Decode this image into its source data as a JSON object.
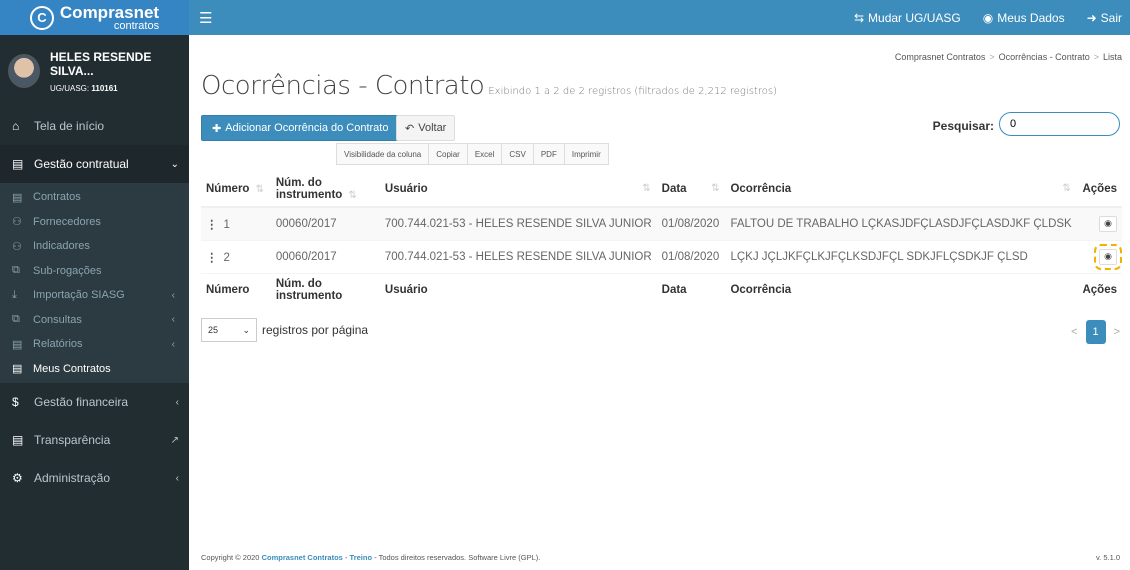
{
  "brand": {
    "name": "Comprasnet",
    "sub": "contratos"
  },
  "topnav": {
    "change_ug": "Mudar UG/UASG",
    "my_data": "Meus Dados",
    "logout": "Sair"
  },
  "user": {
    "name": "HELES RESENDE SILVA...",
    "uasg_label": "UG/UASG:",
    "uasg_code": "110161"
  },
  "sidebar": {
    "home": "Tela de início",
    "contract_mgmt": "Gestão contratual",
    "sub": [
      "Contratos",
      "Fornecedores",
      "Indicadores",
      "Sub-rogações",
      "Importação SIASG",
      "Consultas",
      "Relatórios",
      "Meus Contratos"
    ],
    "financial": "Gestão financeira",
    "transparency": "Transparência",
    "admin": "Administração"
  },
  "breadcrumb": [
    "Comprasnet Contratos",
    "Ocorrências - Contrato",
    "Lista"
  ],
  "page": {
    "title": "Ocorrências - Contrato",
    "subtitle": "Exibindo 1 a 2 de 2 registros (filtrados de 2,212 registros)"
  },
  "buttons": {
    "add": "Adicionar Ocorrência do Contrato",
    "back": "Voltar"
  },
  "search": {
    "label": "Pesquisar:",
    "value": "0"
  },
  "export_buttons": [
    "Visibilidade da coluna",
    "Copiar",
    "Excel",
    "CSV",
    "PDF",
    "Imprimir"
  ],
  "table": {
    "columns": [
      "Número",
      "Núm. do instrumento",
      "Usuário",
      "Data",
      "Ocorrência",
      "Ações"
    ],
    "rows": [
      {
        "numero": "1",
        "instrumento": "00060/2017",
        "usuario": "700.744.021-53 - HELES RESENDE SILVA JUNIOR",
        "data": "01/08/2020",
        "ocorrencia": "FALTOU DE TRABALHO LÇKASJDFÇLASDJFÇLASDJKF ÇLDSK"
      },
      {
        "numero": "2",
        "instrumento": "00060/2017",
        "usuario": "700.744.021-53 - HELES RESENDE SILVA JUNIOR",
        "data": "01/08/2020",
        "ocorrencia": "LÇKJ JÇLJKFÇLKJFÇLKSDJFÇL SDKJFLÇSDKJF ÇLSD"
      }
    ]
  },
  "pagination": {
    "per_page": "25",
    "per_page_label": "registros por página",
    "current": "1",
    "prev": "<",
    "next": ">"
  },
  "footer": {
    "copyright": "Copyright © 2020",
    "app": "Comprasnet Contratos",
    "dash": "-",
    "env": "Treino",
    "rights": "- Todos direitos reservados. Software Livre (GPL).",
    "version": "v. 5.1.0"
  }
}
